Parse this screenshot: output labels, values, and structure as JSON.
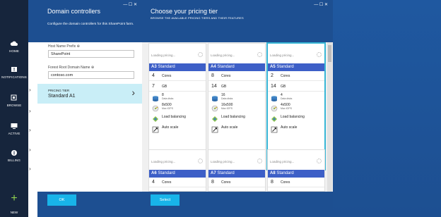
{
  "nav": {
    "home": "HOME",
    "notifications": "NOTIFICATIONS",
    "browse": "BROWSE",
    "active": "ACTIVE",
    "billing": "BILLING",
    "new": "NEW"
  },
  "blade1": {
    "title": "Domain controllers",
    "subtitle": "Configure the domain controllers for this SharePoint farm.",
    "host_label": "Host Name Prefix",
    "host_value": "SharePoint",
    "forest_label": "Forest Root Domain Name",
    "forest_value": "contoso.com",
    "tier_label": "PRICING TIER",
    "tier_value": "Standard A1",
    "ok_label": "OK"
  },
  "blade2": {
    "title": "Choose your pricing tier",
    "subtitle": "BROWSE THE AVAILABLE PRICING TIERS AND THEIR FEATURES",
    "select_label": "Select",
    "loading": "Loading pricing...",
    "labels": {
      "cores": "Cores",
      "gb": "GB",
      "data_disks": "Data disks",
      "max_iops": "Max IOPS",
      "load_balancing": "Load balancing",
      "auto_scale": "Auto scale"
    },
    "tiers": [
      {
        "code": "A3",
        "tier": "Standard",
        "cores": "4",
        "gb": "7",
        "disks": "8",
        "iops": "8x500"
      },
      {
        "code": "A4",
        "tier": "Standard",
        "cores": "8",
        "gb": "14",
        "disks": "16",
        "iops": "16x500"
      },
      {
        "code": "A5",
        "tier": "Standard",
        "cores": "2",
        "gb": "14",
        "disks": "4",
        "iops": "4x500"
      }
    ],
    "tiers2": [
      {
        "code": "A6",
        "tier": "Standard",
        "cores": "4"
      },
      {
        "code": "A7",
        "tier": "Standard",
        "cores": "8"
      },
      {
        "code": "A8",
        "tier": "Standard",
        "cores": "8"
      }
    ],
    "selected_tier": "A5"
  }
}
